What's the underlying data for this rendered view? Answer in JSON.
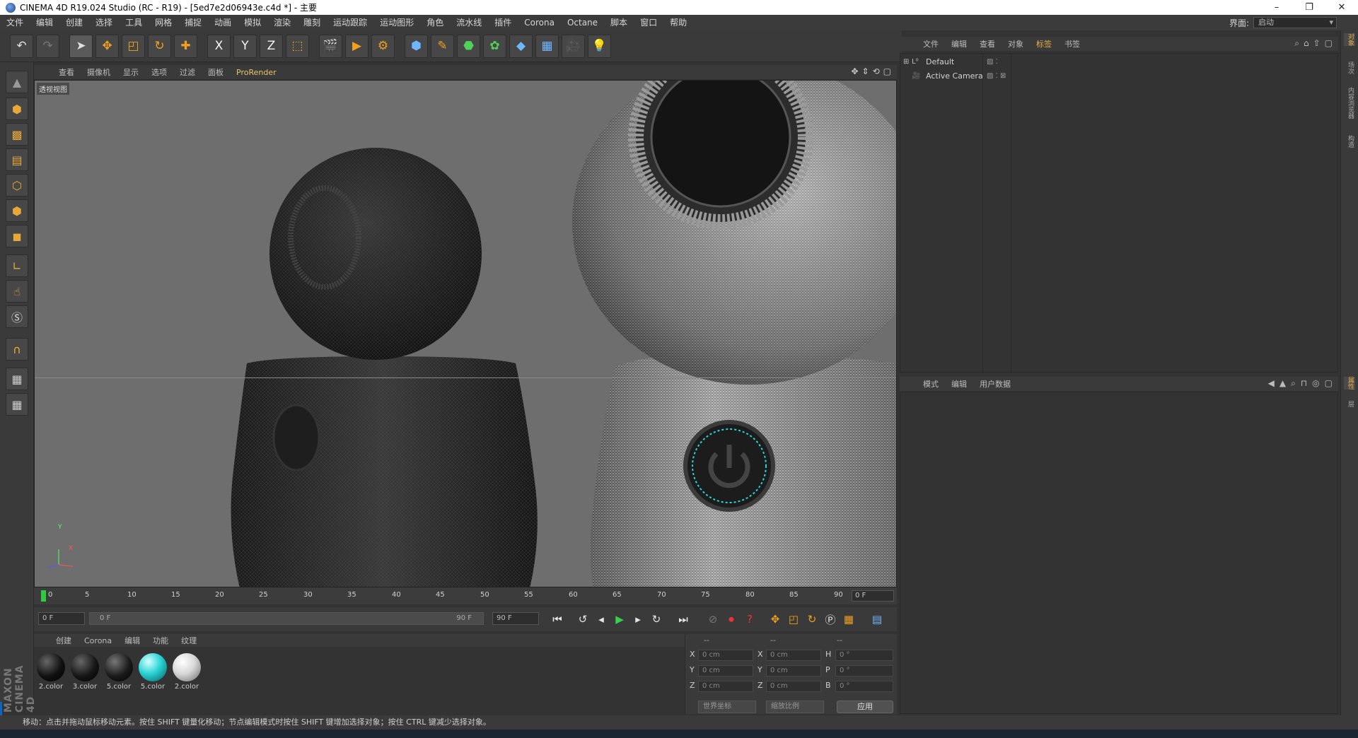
{
  "window": {
    "title": "CINEMA 4D R19.024 Studio (RC - R19) - [5ed7e2d06943e.c4d *] - 主要",
    "controls": {
      "minimize": "–",
      "restore": "❐",
      "close": "✕"
    }
  },
  "menubar": {
    "items": [
      "文件",
      "编辑",
      "创建",
      "选择",
      "工具",
      "网格",
      "捕捉",
      "动画",
      "模拟",
      "渲染",
      "雕刻",
      "运动跟踪",
      "运动图形",
      "角色",
      "流水线",
      "插件",
      "Corona",
      "Octane",
      "脚本",
      "窗口",
      "帮助"
    ],
    "layout_label": "界面:",
    "layout_value": "启动"
  },
  "toolbar": {
    "icons": [
      "undo-icon",
      "redo-icon",
      "select-arrow-icon",
      "move-icon",
      "scale-icon",
      "rotate-icon",
      "live-select-icon",
      "axis-x-icon",
      "axis-y-icon",
      "axis-z-icon",
      "coordinate-system-icon",
      "render-view-icon",
      "render-picture-viewer-icon",
      "render-settings-icon",
      "cube-icon",
      "pen-icon",
      "subdivision-icon",
      "cloner-icon",
      "deformer-icon",
      "floor-icon",
      "camera-icon",
      "light-icon"
    ],
    "axis_x": "X",
    "axis_y": "Y",
    "axis_z": "Z"
  },
  "viewport": {
    "menu": [
      "查看",
      "摄像机",
      "显示",
      "选项",
      "过滤",
      "面板"
    ],
    "prorender": "ProRender",
    "label": "透视视图",
    "axis_y": "Y",
    "axis_x": "X"
  },
  "timeline": {
    "ticks": [
      "0",
      "5",
      "10",
      "15",
      "20",
      "25",
      "30",
      "35",
      "40",
      "45",
      "50",
      "55",
      "60",
      "65",
      "70",
      "75",
      "80",
      "85",
      "90"
    ],
    "current_frame": "0 F"
  },
  "transport": {
    "start_frame": "0 F",
    "range_start": "0 F",
    "range_end": "90 F",
    "end_frame": "90 F"
  },
  "materials": {
    "menu": [
      "创建",
      "Corona",
      "编辑",
      "功能",
      "纹理"
    ],
    "items": [
      {
        "label": "2.color",
        "color": "#111111"
      },
      {
        "label": "3.color",
        "color": "#161616"
      },
      {
        "label": "5.color",
        "color": "#1a1a1a"
      },
      {
        "label": "5.color",
        "color": "#2ad4d6"
      },
      {
        "label": "2.color",
        "color": "#d8d8d8"
      }
    ]
  },
  "coordinates": {
    "headers": [
      "--",
      "--",
      "--"
    ],
    "rows": [
      {
        "a": "X",
        "a_val": "0 cm",
        "b": "X",
        "b_val": "0 cm",
        "c": "H",
        "c_val": "0 °"
      },
      {
        "a": "Y",
        "a_val": "0 cm",
        "b": "Y",
        "b_val": "0 cm",
        "c": "P",
        "c_val": "0 °"
      },
      {
        "a": "Z",
        "a_val": "0 cm",
        "b": "Z",
        "b_val": "0 cm",
        "c": "B",
        "c_val": "0 °"
      }
    ],
    "mode_select": "世界坐标",
    "scale_select": "缩放比例",
    "apply_label": "应用"
  },
  "object_manager": {
    "menu": [
      "文件",
      "编辑",
      "查看",
      "对象",
      "标签",
      "书签"
    ],
    "active_menu_index": 4,
    "objects": [
      {
        "name": "Default"
      },
      {
        "name": "Active Camera"
      }
    ]
  },
  "attribute_manager": {
    "menu": [
      "模式",
      "编辑",
      "用户数据"
    ]
  },
  "right_tabs": [
    "对象",
    "场次",
    "内容浏览器",
    "构造"
  ],
  "right_tabs_lower": [
    "属性",
    "层"
  ],
  "statusbar": {
    "text": "移动：点击并拖动鼠标移动元素。按住 SHIFT 键量化移动；节点编辑模式时按住 SHIFT 键增加选择对象；按住 CTRL 键减少选择对象。"
  },
  "brand": {
    "text": "MAXON CINEMA 4D"
  },
  "colors": {
    "accent": "#e6b04a",
    "playhead": "#2ecc40",
    "power_ring": "#2ad4d6"
  }
}
